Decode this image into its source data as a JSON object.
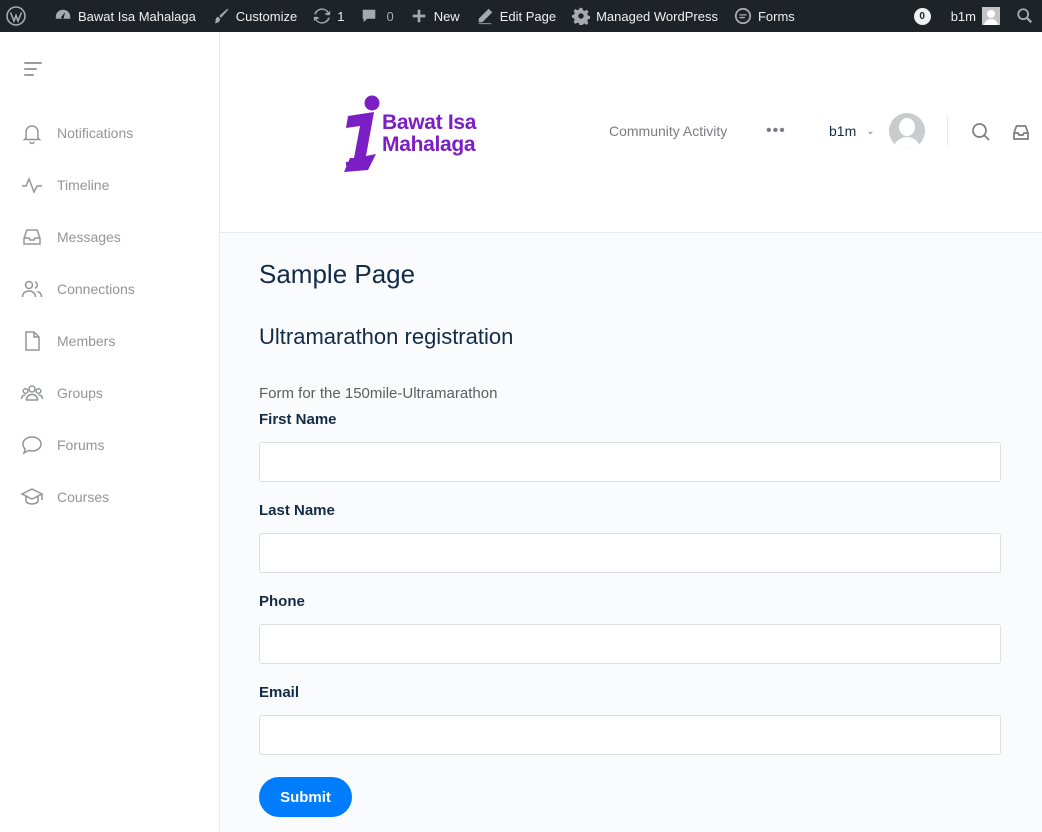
{
  "adminbar": {
    "site_name": "Bawat Isa Mahalaga",
    "customize": "Customize",
    "updates_count": "1",
    "comments_count": "0",
    "new_label": "New",
    "edit_page": "Edit Page",
    "managed_wp": "Managed WordPress",
    "forms": "Forms",
    "notif_count": "0",
    "user": "b1m"
  },
  "sidebar": {
    "items": [
      {
        "label": "Notifications",
        "icon": "bell-icon"
      },
      {
        "label": "Timeline",
        "icon": "activity-icon"
      },
      {
        "label": "Messages",
        "icon": "inbox-icon"
      },
      {
        "label": "Connections",
        "icon": "users-icon"
      },
      {
        "label": "Members",
        "icon": "file-icon"
      },
      {
        "label": "Groups",
        "icon": "group-icon"
      },
      {
        "label": "Forums",
        "icon": "chat-icon"
      },
      {
        "label": "Courses",
        "icon": "graduation-cap-icon"
      }
    ]
  },
  "header": {
    "logo_line1": "Bawat Isa",
    "logo_line2": "Mahalaga",
    "nav_link": "Community Activity",
    "nav_more": "•••",
    "user_name": "b1m",
    "user_chevron": "⌄"
  },
  "main": {
    "page_title": "Sample Page",
    "form_title": "Ultramarathon registration",
    "form_description": "Form for the 150mile-Ultramarathon",
    "fields": [
      {
        "label": "First Name",
        "value": ""
      },
      {
        "label": "Last Name",
        "value": ""
      },
      {
        "label": "Phone",
        "value": ""
      },
      {
        "label": "Email",
        "value": ""
      }
    ],
    "submit_label": "Submit"
  },
  "colors": {
    "adminbar_bg": "#1d2327",
    "accent": "#007cff",
    "logo_purple": "#7b1fc4",
    "page_bg": "#fafbfd"
  }
}
